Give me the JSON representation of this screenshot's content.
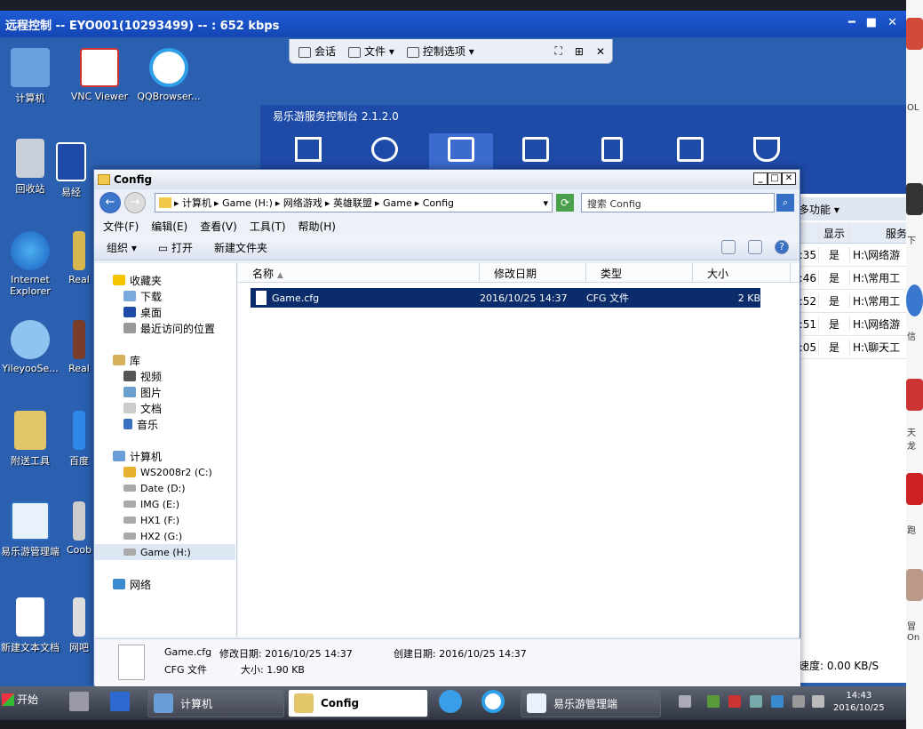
{
  "remote": {
    "title": "远程控制 -- EYO001(10293499) -- : 652 kbps",
    "toolbar": {
      "chat": "会话",
      "file": "文件",
      "control": "控制选项"
    }
  },
  "desktop_icons": [
    "计算机",
    "VNC Viewer",
    "QQBrowser...",
    "回收站",
    "易经",
    "Internet Explorer",
    "Real",
    "YileyooSe...",
    "Real",
    "附送工具",
    "百度",
    "易乐游管理端",
    "Coob",
    "新建文本文档",
    "网吧"
  ],
  "console": {
    "title": "易乐游服务控制台 2.1.2.0",
    "more_label": "多功能",
    "col_show": "显示",
    "col_service": "服务",
    "rows": [
      {
        "time": ":35",
        "show": "是",
        "path": "H:\\网络游"
      },
      {
        "time": ":46",
        "show": "是",
        "path": "H:\\常用工"
      },
      {
        "time": ":52",
        "show": "是",
        "path": "H:\\常用工"
      },
      {
        "time": ":51",
        "show": "是",
        "path": "H:\\网络游"
      },
      {
        "time": ":05",
        "show": "是",
        "path": "H:\\聊天工"
      }
    ],
    "speed": "速度: 0.00 KB/S"
  },
  "explorer": {
    "title": "Config",
    "address": [
      "计算机",
      "Game (H:)",
      "网络游戏",
      "英雄联盟",
      "Game",
      "Config"
    ],
    "search_placeholder": "搜索 Config",
    "menu": [
      "文件(F)",
      "编辑(E)",
      "查看(V)",
      "工具(T)",
      "帮助(H)"
    ],
    "commands": {
      "organize": "组织",
      "open": "打开",
      "new_folder": "新建文件夹"
    },
    "nav": {
      "favorites": "收藏夹",
      "downloads": "下载",
      "desktop": "桌面",
      "recent": "最近访问的位置",
      "libraries": "库",
      "videos": "视频",
      "pictures": "图片",
      "documents": "文档",
      "music": "音乐",
      "computer": "计算机",
      "drive_c": "WS2008r2 (C:)",
      "drive_d": "Date (D:)",
      "drive_e": "IMG (E:)",
      "drive_f": "HX1 (F:)",
      "drive_g": "HX2 (G:)",
      "drive_h": "Game (H:)",
      "network": "网络"
    },
    "columns": {
      "name": "名称",
      "modified": "修改日期",
      "type": "类型",
      "size": "大小"
    },
    "file": {
      "name": "Game.cfg",
      "modified": "2016/10/25 14:37",
      "type": "CFG 文件",
      "size": "2 KB"
    },
    "details": {
      "name": "Game.cfg",
      "modified_label": "修改日期: 2016/10/25 14:37",
      "created_label": "创建日期: 2016/10/25 14:37",
      "type": "CFG 文件",
      "size_label": "大小: 1.90 KB"
    }
  },
  "taskbar": {
    "start": "开始",
    "items": [
      "计算机",
      "Config",
      "易乐游管理端"
    ],
    "time": "14:43",
    "date": "2016/10/25"
  },
  "outside": {
    "t1": "下",
    "t2": "信",
    "t3": "天龙",
    "t4": "跑",
    "t5": "冒",
    "t6": "On",
    "t7": "OL"
  },
  "colors": {
    "titlebar": "#1f5bd6",
    "console_header": "#1e4aa8",
    "selected_row": "#0b2c6a"
  }
}
